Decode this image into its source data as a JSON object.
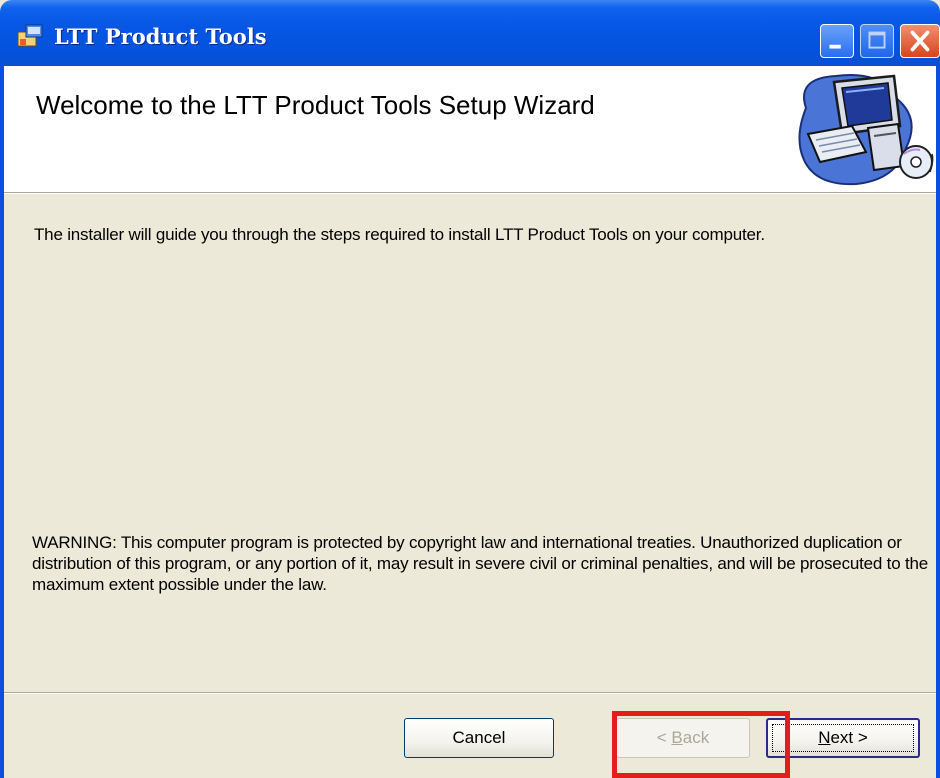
{
  "window": {
    "title": "LTT Product Tools",
    "icon": "installer-package-icon"
  },
  "titlebar_buttons": {
    "minimize_icon": "minimize-icon",
    "maximize_icon": "maximize-icon",
    "close_icon": "close-icon"
  },
  "header": {
    "title": "Welcome to the LTT Product Tools Setup Wizard",
    "graphic": "computer-setup-graphic"
  },
  "body": {
    "intro": "The installer will guide you through the steps required to install LTT Product Tools on your computer.",
    "warning": "WARNING: This computer program is protected by copyright law and international treaties. Unauthorized duplication or distribution of this program, or any portion of it, may result in severe civil or criminal penalties, and will be prosecuted to the maximum extent possible under the law."
  },
  "buttons": {
    "cancel": "Cancel",
    "back_prefix": "< ",
    "back_accel": "B",
    "back_rest": "ack",
    "next_accel": "N",
    "next_rest": "ext >"
  },
  "colors": {
    "titlebar": "#0a4fe0",
    "dialog_bg": "#ece9d8",
    "highlight": "#e31c1c"
  }
}
